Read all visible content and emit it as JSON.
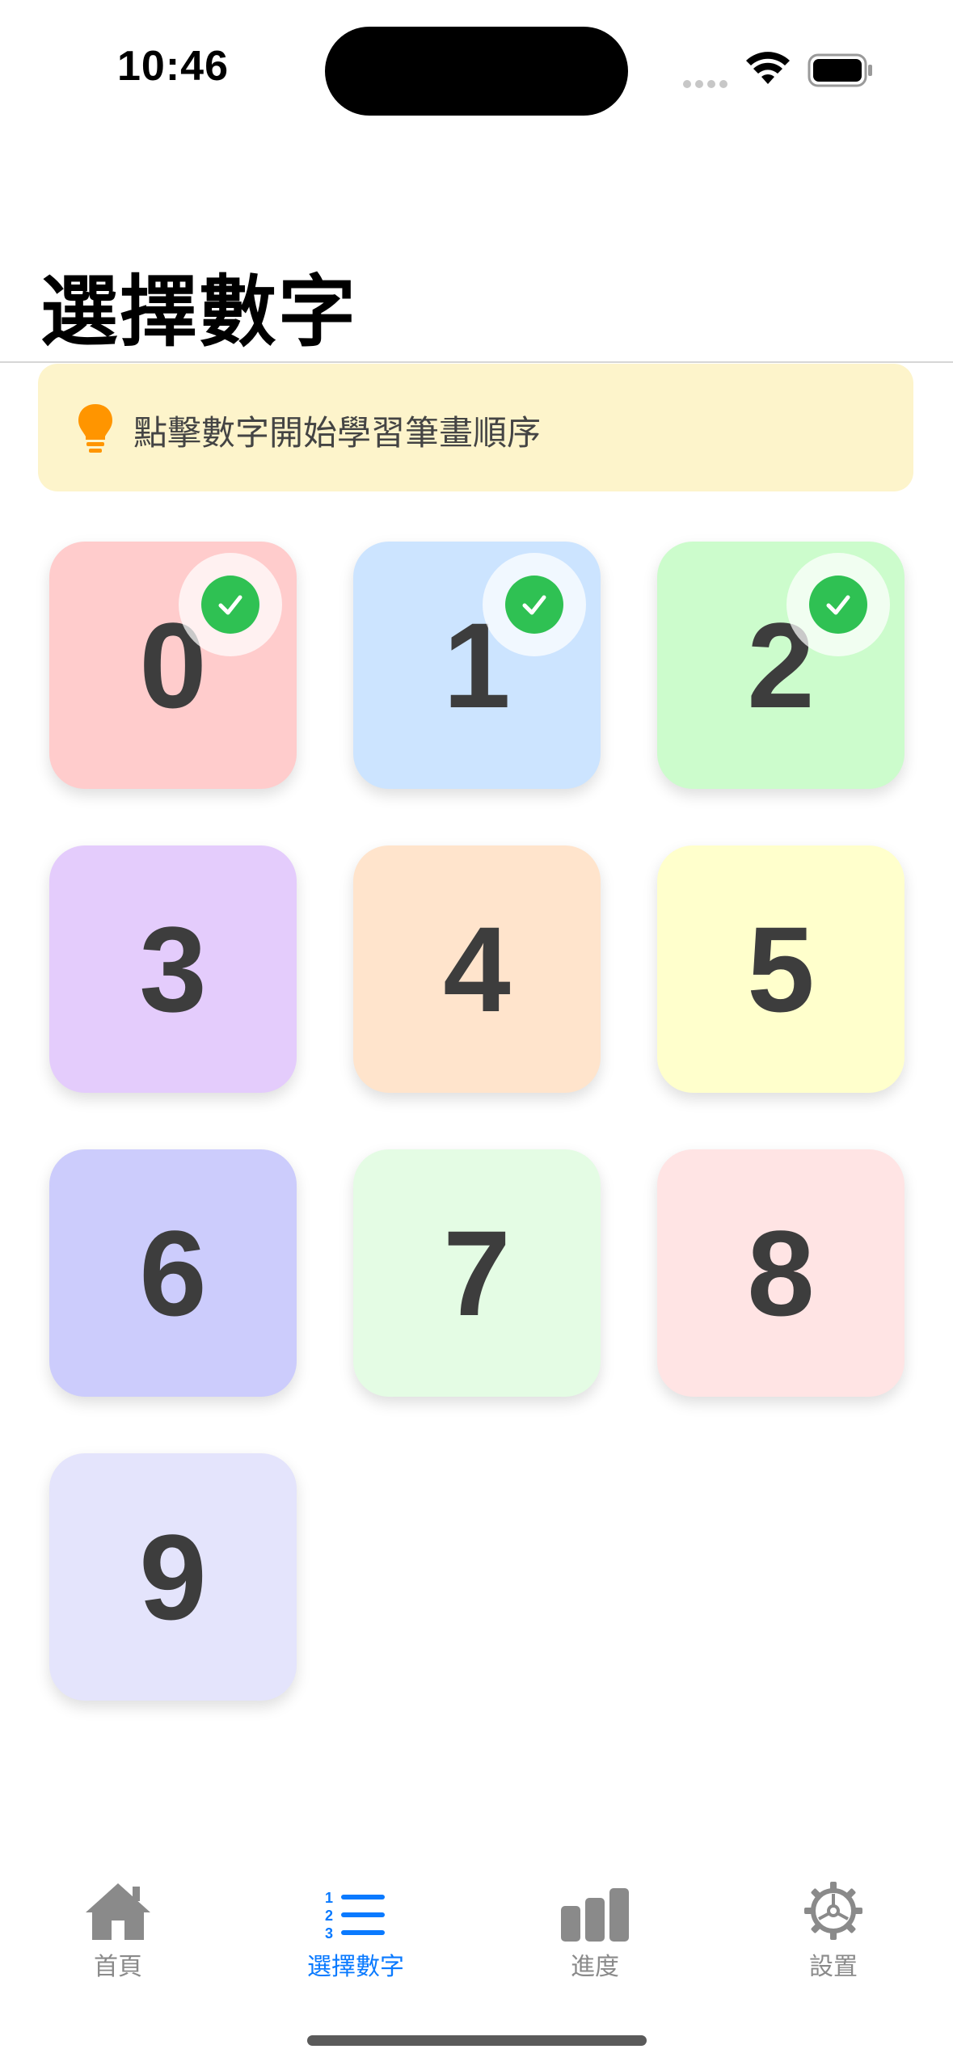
{
  "status_bar": {
    "time": "10:46"
  },
  "header": {
    "title": "選擇數字"
  },
  "hint": {
    "icon": "lightbulb-icon",
    "text": "點擊數字開始學習筆畫順序"
  },
  "tiles": [
    {
      "label": "0",
      "color": "#ffcccc",
      "completed": true
    },
    {
      "label": "1",
      "color": "#cce4ff",
      "completed": true
    },
    {
      "label": "2",
      "color": "#ccfccc",
      "completed": true
    },
    {
      "label": "3",
      "color": "#e4ccfc",
      "completed": false
    },
    {
      "label": "4",
      "color": "#ffe4cc",
      "completed": false
    },
    {
      "label": "5",
      "color": "#ffffcc",
      "completed": false
    },
    {
      "label": "6",
      "color": "#ccccfc",
      "completed": false
    },
    {
      "label": "7",
      "color": "#e4fce4",
      "completed": false
    },
    {
      "label": "8",
      "color": "#ffe4e4",
      "completed": false
    },
    {
      "label": "9",
      "color": "#e4e4fc",
      "completed": false
    }
  ],
  "tab_bar": {
    "items": [
      {
        "label": "首頁",
        "icon": "house-icon",
        "active": false
      },
      {
        "label": "選擇數字",
        "icon": "numbered-list-icon",
        "active": true
      },
      {
        "label": "進度",
        "icon": "bar-chart-icon",
        "active": false
      },
      {
        "label": "設置",
        "icon": "gear-icon",
        "active": false
      }
    ]
  },
  "colors": {
    "accent": "#0a7aff",
    "check": "#2fc153",
    "hint_bg": "#fdf4cb"
  }
}
